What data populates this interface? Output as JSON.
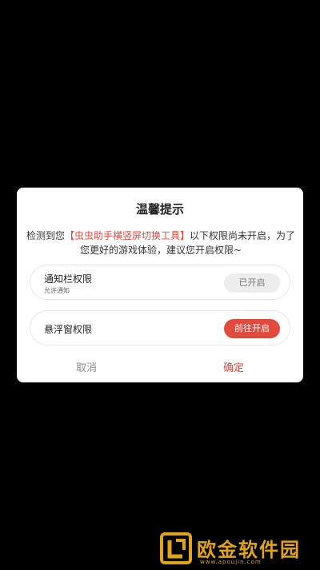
{
  "dialog": {
    "title": "温馨提示",
    "message_prefix": "检测到您",
    "app_name": "【虫虫助手横竖屏切换工具】",
    "message_suffix": "以下权限尚未开启，为了您更好的游戏体验，建议您开启权限~",
    "permissions": [
      {
        "title": "通知栏权限",
        "subtitle": "允许通知",
        "button_label": "已开启"
      },
      {
        "title": "悬浮窗权限",
        "button_label": "前往开启"
      }
    ],
    "cancel_label": "取消",
    "confirm_label": "确定"
  },
  "watermark": {
    "text": "欧金软件园",
    "url": "www.apoujin.com"
  },
  "colors": {
    "accent": "#e14a3c",
    "background": "#000000",
    "watermark": "#e0a31a"
  }
}
